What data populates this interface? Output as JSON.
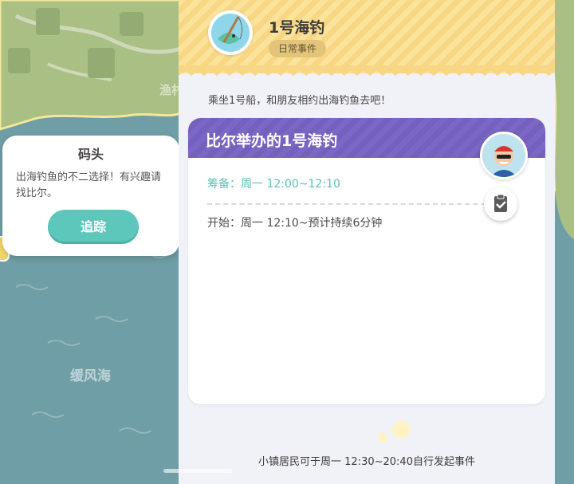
{
  "map": {
    "labels": {
      "fishing_village": "渔村",
      "sea": "缓风海"
    }
  },
  "dock_popup": {
    "title": "码头",
    "description": "出海钓鱼的不二选择！有兴趣请找比尔。",
    "track_label": "追踪"
  },
  "event": {
    "title": "1号海钓",
    "tag": "日常事件",
    "intro": "乘坐1号船，和朋友相约出海钓鱼去吧！",
    "icon": "fish-rod-icon",
    "session": {
      "title": "比尔举办的1号海钓",
      "prep": "筹备：周一 12:00~12:10",
      "start": "开始：周一 12:10~预计持续6分钟",
      "host_avatar": "bill-avatar",
      "action_icon": "clipboard-check-icon"
    },
    "footer": "小镇居民可于周一 12:30~20:40自行发起事件"
  },
  "colors": {
    "accent_teal": "#5ec7bc",
    "header_purple": "#7c66c6",
    "header_yellow": "#f8d784",
    "tag_gold": "#e3c57a"
  }
}
